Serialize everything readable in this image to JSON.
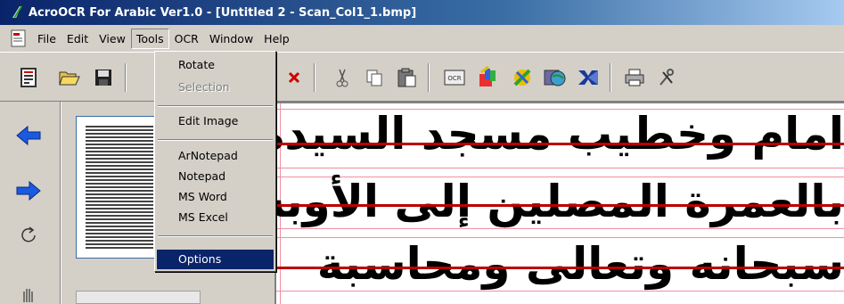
{
  "window": {
    "title": "AcroOCR For Arabic Ver1.0 - [Untitled 2 - Scan_Col1_1.bmp]"
  },
  "menubar": {
    "items": [
      "File",
      "Edit",
      "View",
      "Tools",
      "OCR",
      "Window",
      "Help"
    ],
    "active": "Tools"
  },
  "tools_menu": {
    "items": [
      {
        "label": "Rotate",
        "enabled": true
      },
      {
        "label": "Selection",
        "enabled": false
      },
      {
        "label": "Edit Image",
        "enabled": true
      },
      {
        "label": "ArNotepad",
        "enabled": true
      },
      {
        "label": "Notepad",
        "enabled": true
      },
      {
        "label": "MS Word",
        "enabled": true
      },
      {
        "label": "MS Excel",
        "enabled": true
      },
      {
        "label": "Options",
        "enabled": true,
        "selected": true
      }
    ]
  },
  "toolbar": {
    "icons": [
      "report-icon",
      "open-folder-icon",
      "save-icon",
      "delete-icon",
      "cut-icon",
      "copy-icon",
      "paste-icon",
      "ocr-icon",
      "paint-icon",
      "settings-icon",
      "world-icon",
      "excel-icon",
      "print-icon",
      "tools-icon"
    ]
  },
  "left_toolbar": {
    "icons": [
      "arrow-left-icon",
      "arrow-right-icon",
      "rotate-icon",
      "hand-icon"
    ]
  },
  "document": {
    "lines": [
      "امام وخطيب مسجد السيدة",
      "بالعمرة المصلين إلى الأوبة",
      "سبحانه وتعالى ومحاسبة"
    ]
  },
  "colors": {
    "titlebar_start": "#0a246a",
    "menu_highlight": "#0a246a",
    "delete_red": "#cc0000",
    "baseline_red": "#b00000",
    "guide_pink": "#f090a0"
  }
}
